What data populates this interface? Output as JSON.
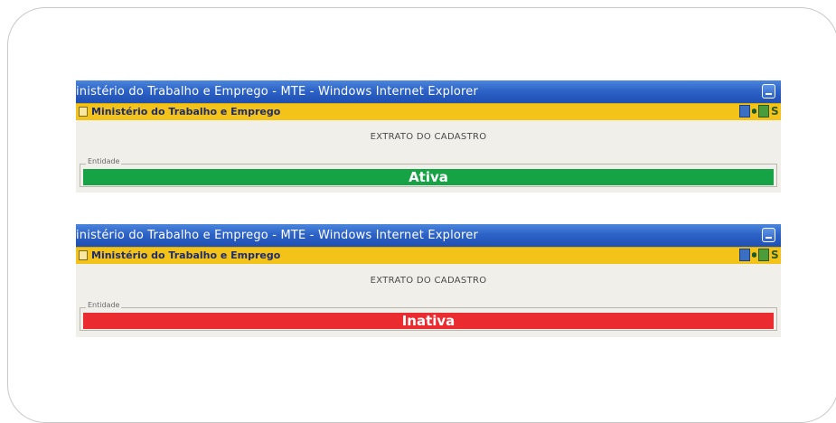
{
  "screenshots": [
    {
      "window_title": "inistério do Trabalho e Emprego - MTE - Windows Internet Explorer",
      "page_title": "Ministério do Trabalho e Emprego",
      "heading": "EXTRATO DO CADASTRO",
      "field_legend": "Entidade",
      "status_text": "Ativa",
      "status_color": "#16a346"
    },
    {
      "window_title": "inistério do Trabalho e Emprego - MTE - Windows Internet Explorer",
      "page_title": "Ministério do Trabalho e Emprego",
      "heading": "EXTRATO DO CADASTRO",
      "field_legend": "Entidade",
      "status_text": "Inativa",
      "status_color": "#ea2b2f"
    }
  ],
  "icons": {
    "toolbar_letter": "S"
  }
}
